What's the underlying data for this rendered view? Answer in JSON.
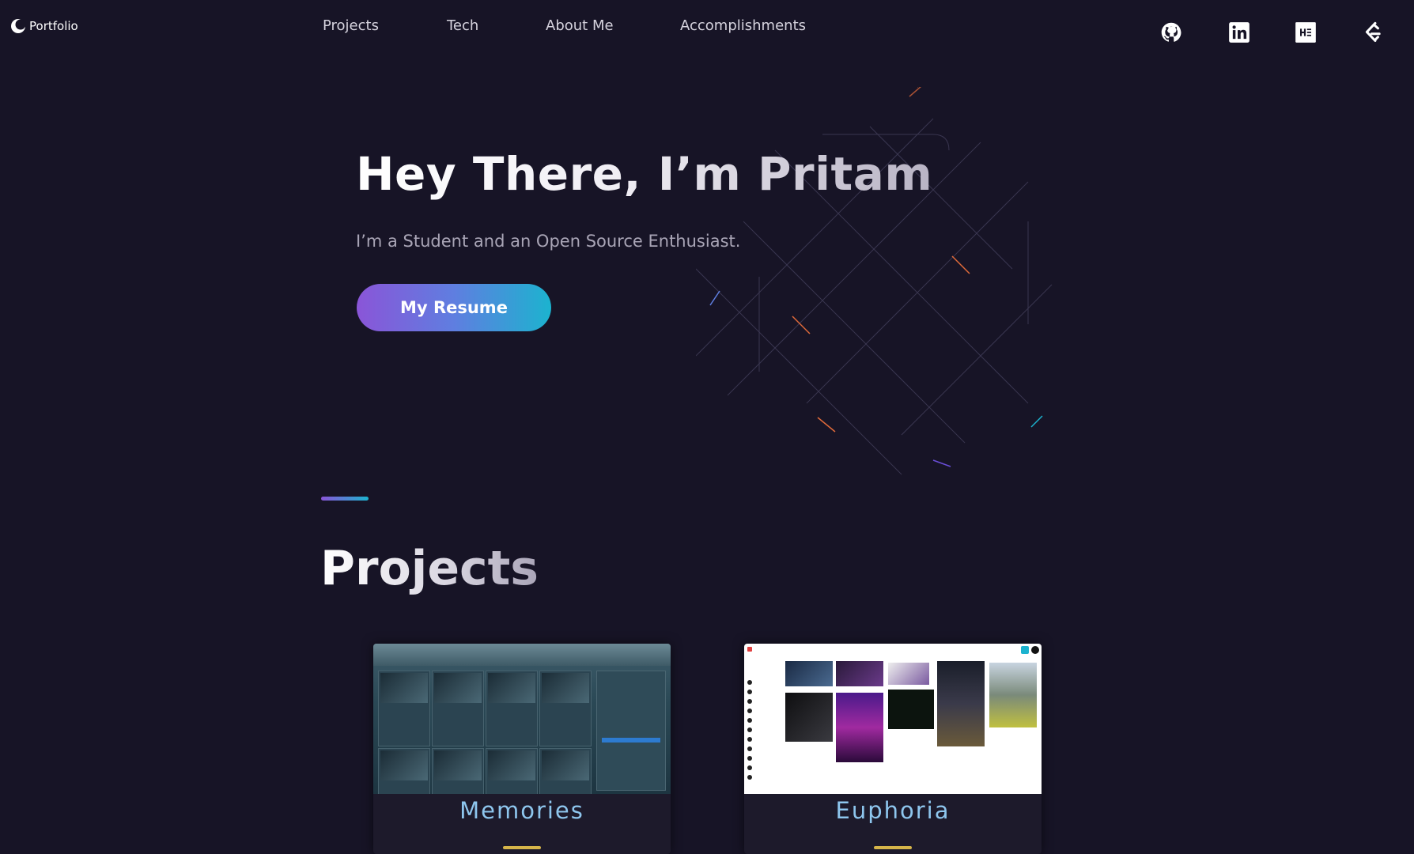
{
  "nav": {
    "logo_text": "Portfolio",
    "links": [
      "Projects",
      "Tech",
      "About Me",
      "Accomplishments"
    ],
    "socials": [
      "github-icon",
      "linkedin-icon",
      "hashnode-icon",
      "leetcode-icon"
    ]
  },
  "hero": {
    "title": "Hey There, I’m Pritam",
    "subtitle": "I’m a Student and an Open Source Enthusiast.",
    "button_label": "My Resume"
  },
  "projects": {
    "section_title": "Projects",
    "cards": [
      {
        "title": "Memories"
      },
      {
        "title": "Euphoria"
      }
    ]
  },
  "colors": {
    "background": "#171426",
    "gradient_start": "#8a55d8",
    "gradient_end": "#1cb3cf",
    "card_title": "#8ec6ee",
    "card_underline": "#d6b54a"
  }
}
